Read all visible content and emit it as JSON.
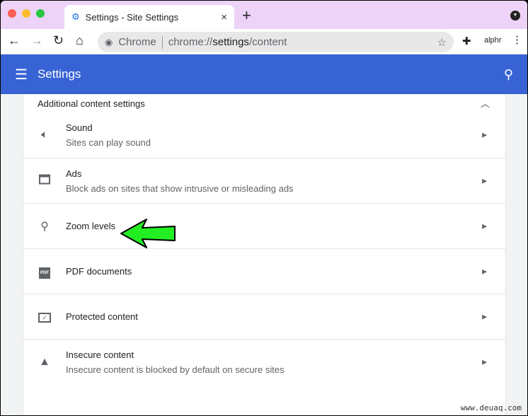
{
  "browser": {
    "tab_title": "Settings - Site Settings",
    "close": "×",
    "new_tab": "+",
    "omnibox_origin": "Chrome",
    "url_prefix": "chrome://",
    "url_path": "settings",
    "url_suffix": "/content",
    "extension_label": "alphr"
  },
  "header": {
    "title": "Settings"
  },
  "section": {
    "title": "Additional content settings"
  },
  "items": [
    {
      "label": "Sound",
      "sub": "Sites can play sound",
      "icon": "speaker-icon"
    },
    {
      "label": "Ads",
      "sub": "Block ads on sites that show intrusive or misleading ads",
      "icon": "window-icon"
    },
    {
      "label": "Zoom levels",
      "sub": "",
      "icon": "search-icon"
    },
    {
      "label": "PDF documents",
      "sub": "",
      "icon": "pdf-icon",
      "icon_text": "PDF"
    },
    {
      "label": "Protected content",
      "sub": "",
      "icon": "monitor-check-icon"
    },
    {
      "label": "Insecure content",
      "sub": "Insecure content is blocked by default on secure sites",
      "icon": "warning-icon"
    }
  ],
  "annotation": {
    "arrow_color": "#22ee22"
  },
  "watermark": "www.deuaq.com",
  "colors": {
    "header": "#3763d4",
    "tabbar": "#ecd3f7"
  }
}
